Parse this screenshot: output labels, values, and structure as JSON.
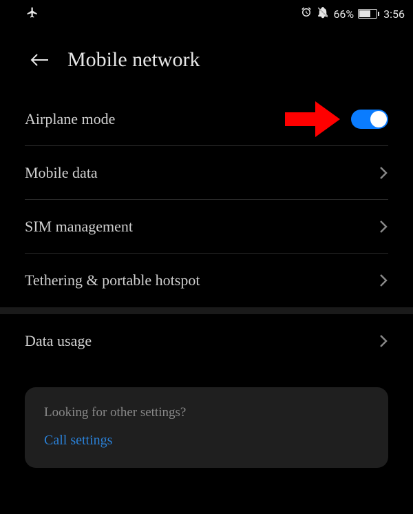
{
  "status_bar": {
    "battery_percent": "66%",
    "time": "3:56"
  },
  "header": {
    "title": "Mobile network"
  },
  "settings": {
    "airplane_mode": {
      "label": "Airplane mode",
      "toggle_on": true
    },
    "mobile_data": {
      "label": "Mobile data"
    },
    "sim_management": {
      "label": "SIM management"
    },
    "tethering": {
      "label": "Tethering & portable hotspot"
    },
    "data_usage": {
      "label": "Data usage"
    }
  },
  "footer": {
    "question": "Looking for other settings?",
    "link_text": "Call settings"
  },
  "colors": {
    "accent": "#0a7cff",
    "link": "#2a7fd4",
    "annotation": "#ff0000"
  }
}
